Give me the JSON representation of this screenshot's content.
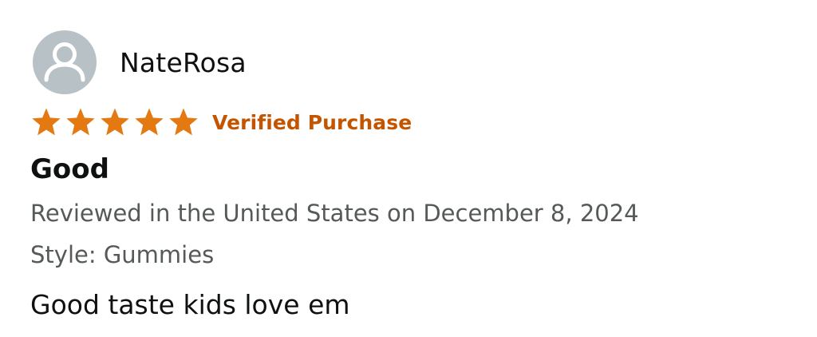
{
  "reviewer": {
    "name": "NateRosa",
    "avatar_icon": "default-user-avatar-icon",
    "avatar_bg": "#b7c1c6"
  },
  "rating": {
    "stars": 5,
    "max": 5,
    "star_color": "#e47911"
  },
  "badge": {
    "label": "Verified Purchase",
    "color": "#c45500"
  },
  "review": {
    "title": "Good",
    "date_line": "Reviewed in the United States on December 8, 2024",
    "style_line": "Style: Gummies",
    "text": "Good taste kids love em"
  }
}
